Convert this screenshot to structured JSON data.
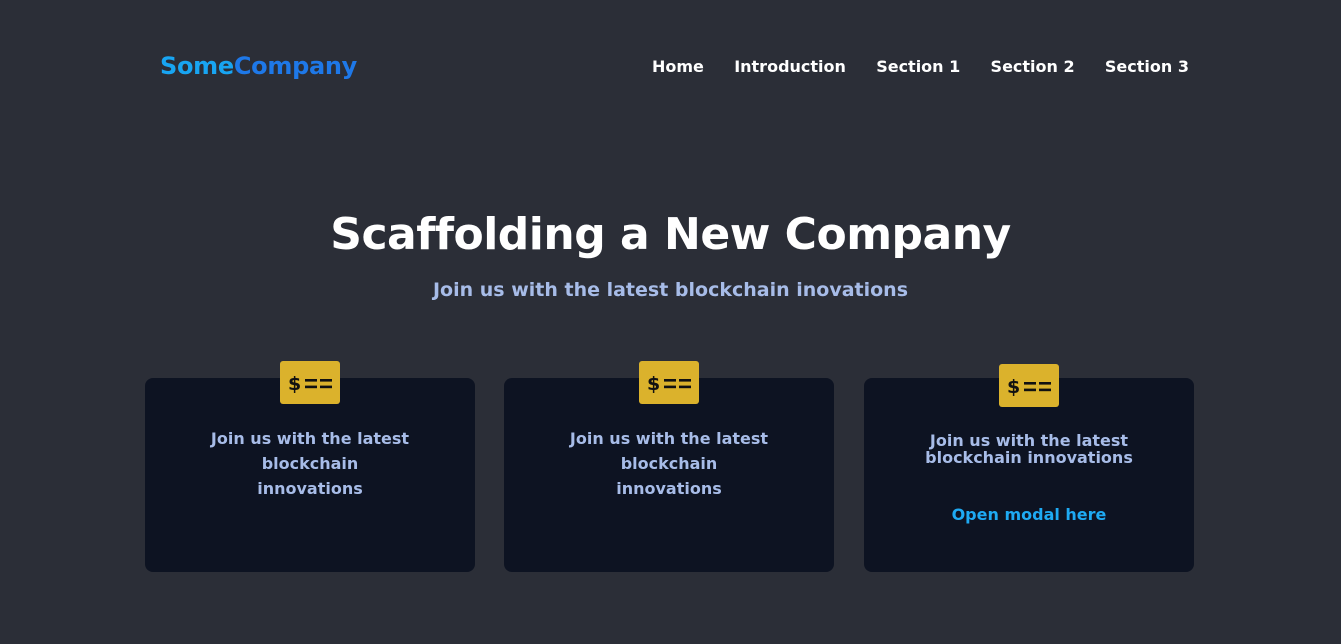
{
  "header": {
    "logo_part1": "Some",
    "logo_part2": "Company",
    "nav": [
      "Home",
      "Introduction",
      "Section 1",
      "Section 2",
      "Section 3"
    ]
  },
  "hero": {
    "title": "Scaffolding a New Company",
    "subtitle": "Join us with the latest blockchain inovations"
  },
  "cards": [
    {
      "icon": "money-bill-icon",
      "text": "Join us with the latest blockchain innovations"
    },
    {
      "icon": "money-bill-icon",
      "text": "Join us with the latest blockchain innovations"
    },
    {
      "icon": "money-bill-icon",
      "text": "Join us with the latest blockchain innovations",
      "link": "Open modal here"
    }
  ],
  "colors": {
    "background": "#2b2e37",
    "card": "#0d1322",
    "accent": "#1eaaf3",
    "icon_bg": "#dbb22c",
    "subtitle": "#a7bce8"
  }
}
